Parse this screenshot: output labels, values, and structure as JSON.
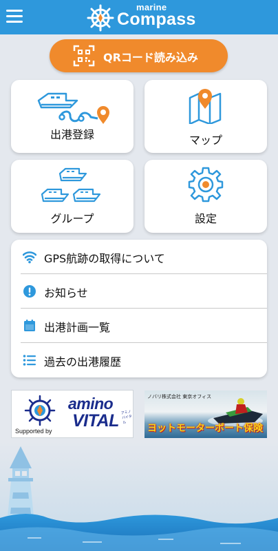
{
  "header": {
    "logo_small": "marine",
    "logo_big": "Compass",
    "bg_color": "#2e98dc",
    "menu_icon": "hamburger-menu-icon"
  },
  "qr_button": {
    "label": "QRコード読み込み",
    "color": "#f08a2c",
    "icon": "qr-code-icon"
  },
  "grid": [
    {
      "label": "出港登録",
      "icon": "boat-route-icon"
    },
    {
      "label": "マップ",
      "icon": "map-pin-icon"
    },
    {
      "label": "グループ",
      "icon": "boat-group-icon"
    },
    {
      "label": "設定",
      "icon": "gear-icon"
    }
  ],
  "list": [
    {
      "label": "GPS航跡の取得について",
      "icon": "wifi-icon"
    },
    {
      "label": "お知らせ",
      "icon": "info-icon"
    },
    {
      "label": "出港計画一覧",
      "icon": "calendar-icon"
    },
    {
      "label": "過去の出港履歴",
      "icon": "list-icon"
    }
  ],
  "banners": {
    "amino": {
      "supported_by": "Supported by",
      "brand_line1": "amino",
      "brand_line2": "VITAL",
      "brand_kana": "アミノバイタル"
    },
    "insurance": {
      "heading": "ノバリ株式会社 東京オフィス",
      "title": "ヨットモーターボート保険"
    }
  },
  "accent_color": "#2e98dc"
}
